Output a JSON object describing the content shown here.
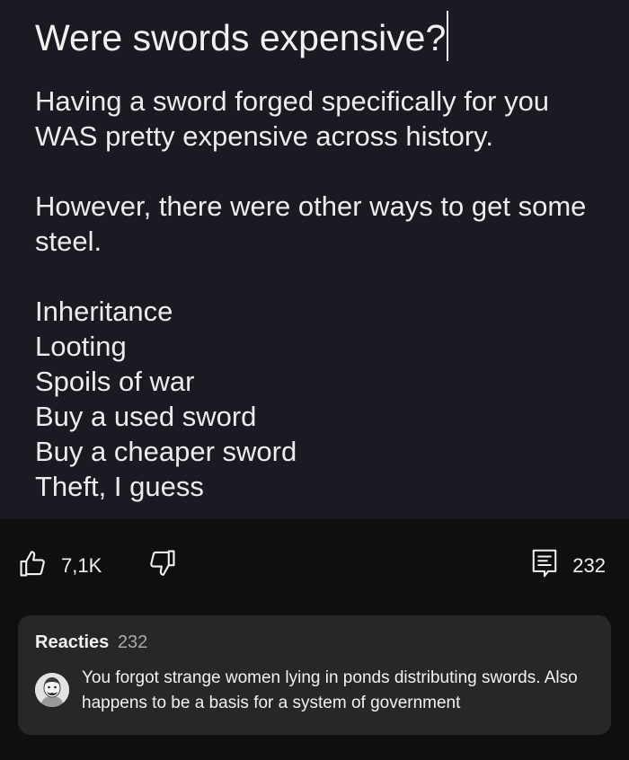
{
  "post": {
    "title": "Were swords expensive?",
    "body": [
      "Having a sword forged specifically for you",
      "WAS pretty expensive across history.",
      "",
      "However, there were other ways to get some",
      "steel.",
      "",
      "Inheritance",
      "Looting",
      "Spoils of war",
      "Buy a used sword",
      "Buy a cheaper sword",
      "Theft, I guess"
    ]
  },
  "actions": {
    "like_count": "7,1K",
    "comment_count": "232",
    "icons": {
      "like": "thumbs-up-icon",
      "dislike": "thumbs-down-icon",
      "comments": "comment-icon"
    }
  },
  "comments": {
    "label": "Reacties",
    "count": "232",
    "top_comment": {
      "text": "You forgot strange women lying in ponds distributing swords. Also happens to be a basis for a system of government"
    }
  },
  "colors": {
    "post_background": "#191a22",
    "page_background": "#0f0f0f",
    "comments_background": "#272727"
  }
}
